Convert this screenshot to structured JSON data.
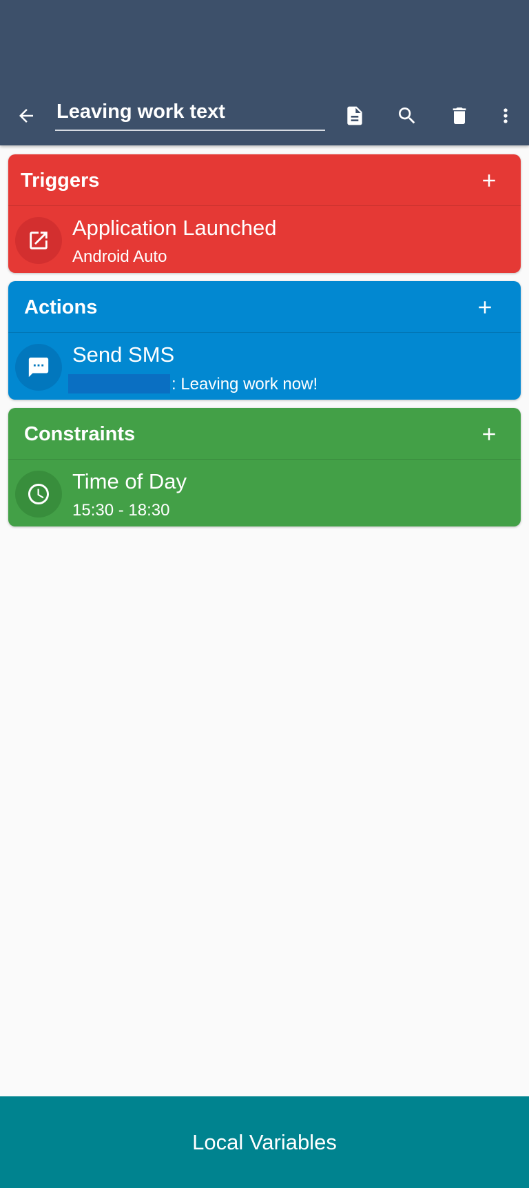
{
  "header": {
    "macro_name": "Leaving work text",
    "back_icon": "arrow-back-icon",
    "actions": [
      "document-icon",
      "search-icon",
      "delete-icon",
      "more-vert-icon"
    ],
    "background": "#3d506a"
  },
  "sections": {
    "triggers": {
      "title": "Triggers",
      "color": "#e53935",
      "item": {
        "title": "Application Launched",
        "subtitle": "Android Auto",
        "icon": "open-in-new-icon"
      }
    },
    "actions": {
      "title": "Actions",
      "color": "#0288d1",
      "item": {
        "title": "Send SMS",
        "subtitle": ": Leaving work now!",
        "icon": "message-icon"
      }
    },
    "constraints": {
      "title": "Constraints",
      "color": "#43a047",
      "item": {
        "title": "Time of Day",
        "subtitle": "15:30 - 18:30",
        "icon": "clock-icon"
      }
    }
  },
  "footer": {
    "label": "Local Variables",
    "color": "#00838f"
  }
}
